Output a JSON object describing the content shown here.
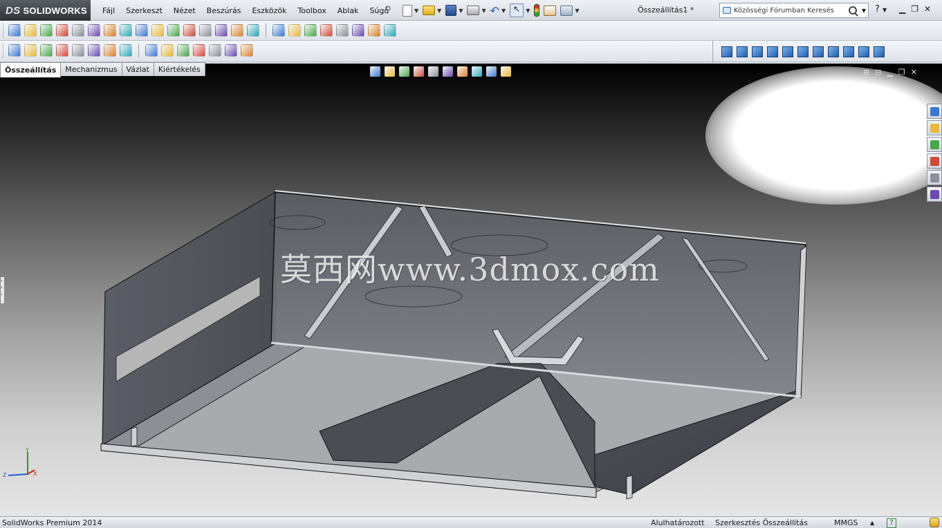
{
  "app": {
    "logo_text": "SOLIDWORKS",
    "logo_mark": "DS"
  },
  "menu": [
    "Fájl",
    "Szerkeszt",
    "Nézet",
    "Beszúrás",
    "Eszközök",
    "Toolbox",
    "Ablak",
    "Súgó"
  ],
  "document": {
    "title": "Összeállítás1 *"
  },
  "search": {
    "placeholder": "Közösségi Fórumban Keresés"
  },
  "help_label": "?",
  "tabs": [
    {
      "label": "Összeállítás",
      "active": true
    },
    {
      "label": "Mechanizmus",
      "active": false
    },
    {
      "label": "Vázlat",
      "active": false
    },
    {
      "label": "Kiértékelés",
      "active": false
    }
  ],
  "watermark": "莫西网www.3dmox.com",
  "status": {
    "product": "SolidWorks Premium 2014",
    "definition": "Alulhatározott",
    "mode": "Szerkesztés Összeállítás",
    "units": "MMGS",
    "units_arrow": "▲"
  },
  "colors": {
    "accent": "#1f5fb0",
    "model_face": "#5e6168",
    "model_glass": "#7d8088"
  },
  "icons": {
    "toolbar_row1": [
      "spell-check-icon",
      "find-icon",
      "measure-icon",
      "mass-props-icon",
      "section-icon",
      "interference-icon",
      "check-icon",
      "checkbox-icon",
      "sum-icon",
      "tools-icon",
      "warning-icon",
      "align-icon",
      "compare-icon",
      "shaded-icon",
      "properties-icon",
      "import-icon",
      "options-icon",
      "appearance-icon",
      "scene-icon",
      "decal-icon",
      "render-icon",
      "camera-icon",
      "light-icon",
      "photoview-icon"
    ],
    "toolbar_row2": [
      "insert-component-icon",
      "mate-icon",
      "linear-pattern-icon",
      "smart-fasteners-icon",
      "move-component-icon",
      "show-hidden-icon",
      "assembly-features-icon",
      "reference-geometry-icon",
      "new-motion-study-icon",
      "bill-of-materials-icon",
      "exploded-view-icon",
      "explode-line-icon",
      "instant3d-icon",
      "update-icon",
      "snapshot-icon"
    ],
    "view_orientations": [
      "normal-to-icon",
      "front-view-icon",
      "back-view-icon",
      "left-view-icon",
      "right-view-icon",
      "top-view-icon",
      "bottom-view-icon",
      "isometric-view-icon",
      "trimetric-view-icon",
      "dimetric-view-icon",
      "view-selector-icon"
    ],
    "heads_up": [
      "zoom-to-fit-icon",
      "zoom-area-icon",
      "previous-view-icon",
      "section-view-icon",
      "view-orientation-icon",
      "display-style-icon",
      "hide-show-icon",
      "edit-appearance-icon",
      "apply-scene-icon",
      "view-settings-icon"
    ],
    "task_pane": [
      "solidworks-resources-icon",
      "design-library-icon",
      "file-explorer-icon",
      "view-palette-icon",
      "appearances-icon",
      "custom-properties-icon"
    ]
  }
}
